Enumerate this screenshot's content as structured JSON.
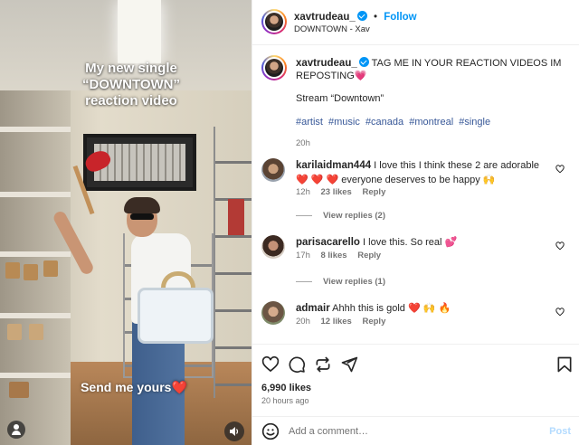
{
  "video": {
    "caption_top": "My new single “DOWNTOWN” reaction video",
    "caption_bottom": "Send me yours❤️"
  },
  "header": {
    "username": "xavtrudeau_",
    "separator": "•",
    "follow_label": "Follow",
    "subtitle": "DOWNTOWN - Xav",
    "more_icon": "more-horizontal-icon"
  },
  "caption": {
    "username": "xavtrudeau_",
    "text": "TAG ME IN YOUR REACTION VIDEOS IM REPOSTING💗",
    "stream": "Stream “Downtown”",
    "hashtags": [
      "#artist",
      "#music",
      "#canada",
      "#montreal",
      "#single"
    ],
    "time": "20h"
  },
  "comments": [
    {
      "username": "karilaidman444",
      "text": "I love this I think these 2 are adorable ❤️ ❤️ ❤️ everyone deserves to be happy 🙌",
      "time": "12h",
      "likes": "23 likes",
      "reply": "Reply",
      "view_replies": "View replies (2)"
    },
    {
      "username": "parisacarello",
      "text": "I love this. So real 💕",
      "time": "17h",
      "likes": "8 likes",
      "reply": "Reply",
      "view_replies": "View replies (1)"
    },
    {
      "username": "admair",
      "text": "Ahhh this is gold ❤️ 🙌 🔥",
      "time": "20h",
      "likes": "12 likes",
      "reply": "Reply"
    }
  ],
  "actions": {
    "icons": [
      "heart-icon",
      "comment-icon",
      "share-icon",
      "send-icon",
      "bookmark-icon"
    ],
    "likes": "6,990 likes",
    "posted": "20 hours ago"
  },
  "add_comment": {
    "placeholder": "Add a comment…",
    "post_label": "Post"
  },
  "colors": {
    "accent": "#0095f6",
    "text": "#262626",
    "muted": "#737373"
  }
}
